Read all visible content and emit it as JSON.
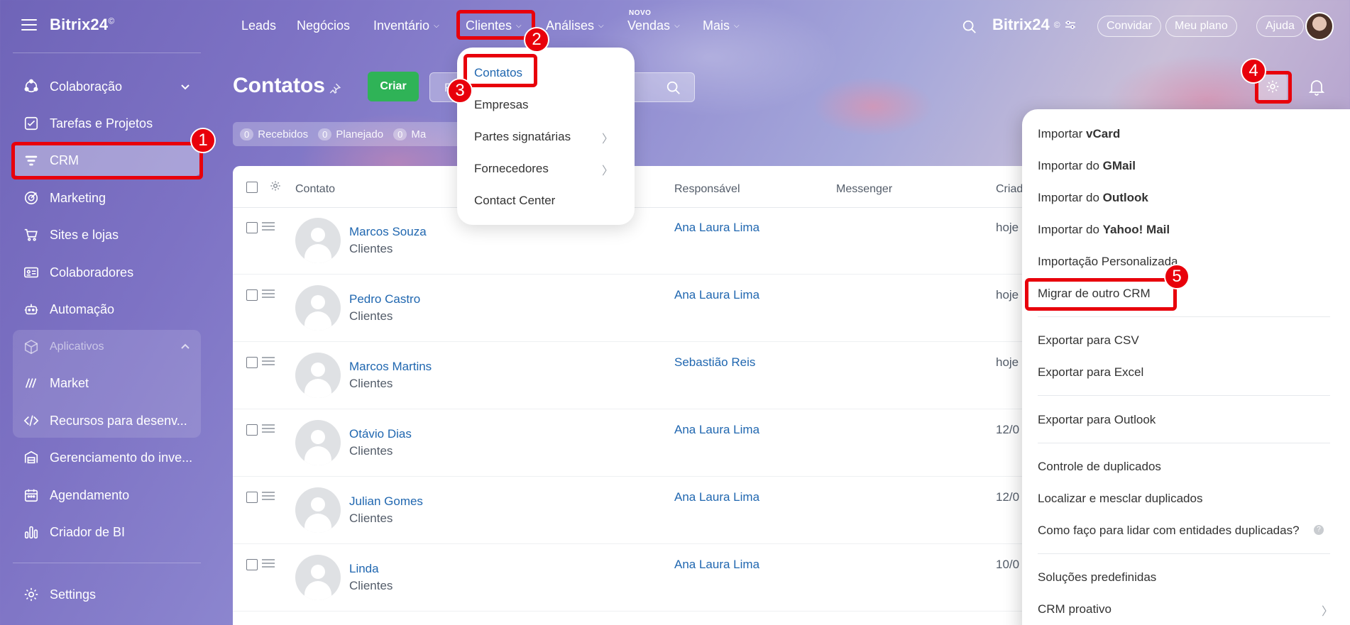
{
  "app": {
    "logo": "Bitrix24",
    "logo_mark": "©"
  },
  "sidebar": {
    "items": [
      {
        "label": "Colaboração"
      },
      {
        "label": "Tarefas e Projetos"
      },
      {
        "label": "CRM"
      },
      {
        "label": "Marketing"
      },
      {
        "label": "Sites e lojas"
      },
      {
        "label": "Colaboradores"
      },
      {
        "label": "Automação"
      },
      {
        "label": "Aplicativos"
      },
      {
        "label": "Market"
      },
      {
        "label": "Recursos para desenv..."
      },
      {
        "label": "Gerenciamento do inve..."
      },
      {
        "label": "Agendamento"
      },
      {
        "label": "Criador de BI"
      },
      {
        "label": "Settings"
      }
    ]
  },
  "topnav": {
    "items": [
      "Leads",
      "Negócios",
      "Inventário",
      "Clientes",
      "Análises",
      "Vendas",
      "Mais"
    ],
    "novo_tag": "NOVO",
    "buttons": {
      "invite": "Convidar",
      "plan": "Meu plano",
      "help": "Ajuda"
    }
  },
  "page": {
    "title": "Contatos",
    "create_button": "Criar",
    "filter_placeholder": "F",
    "counters": [
      {
        "count": "0",
        "label": "Recebidos"
      },
      {
        "count": "0",
        "label": "Planejado"
      },
      {
        "count": "0",
        "label": "Ma"
      }
    ]
  },
  "table": {
    "headers": {
      "contact": "Contato",
      "responsible": "Responsável",
      "messenger": "Messenger",
      "created": "Criad"
    },
    "rows": [
      {
        "name": "Marcos Souza",
        "type": "Clientes",
        "responsible": "Ana Laura Lima",
        "date": "hoje"
      },
      {
        "name": "Pedro Castro",
        "type": "Clientes",
        "responsible": "Ana Laura Lima",
        "date": "hoje"
      },
      {
        "name": "Marcos Martins",
        "type": "Clientes",
        "responsible": "Sebastião Reis",
        "date": "hoje"
      },
      {
        "name": "Otávio Dias",
        "type": "Clientes",
        "responsible": "Ana Laura Lima",
        "date": "12/0"
      },
      {
        "name": "Julian Gomes",
        "type": "Clientes",
        "responsible": "Ana Laura Lima",
        "date": "12/0"
      },
      {
        "name": "Linda",
        "type": "Clientes",
        "responsible": "Ana Laura Lima",
        "date": "10/0"
      }
    ]
  },
  "clients_menu": {
    "items": [
      "Contatos",
      "Empresas",
      "Partes signatárias",
      "Fornecedores",
      "Contact Center"
    ]
  },
  "settings_menu": {
    "import_vcard": [
      "Importar ",
      "vCard"
    ],
    "import_gmail": [
      "Importar do ",
      "GMail"
    ],
    "import_outlook": [
      "Importar do ",
      "Outlook"
    ],
    "import_yahoo": [
      "Importar do ",
      "Yahoo! Mail"
    ],
    "import_custom": "Importação Personalizada",
    "migrate": "Migrar de outro CRM",
    "export_csv": "Exportar para CSV",
    "export_excel": "Exportar para Excel",
    "export_outlook": "Exportar para Outlook",
    "dup_control": "Controle de duplicados",
    "dup_find": "Localizar e mesclar duplicados",
    "dup_help": "Como faço para lidar com entidades duplicadas?",
    "solutions": "Soluções predefinidas",
    "proactive": "CRM proativo"
  },
  "annotations": [
    "1",
    "2",
    "3",
    "4",
    "5"
  ],
  "colors": {
    "accent_red": "#e8000b",
    "create_green": "#2fb357",
    "link_blue": "#2067b0"
  }
}
